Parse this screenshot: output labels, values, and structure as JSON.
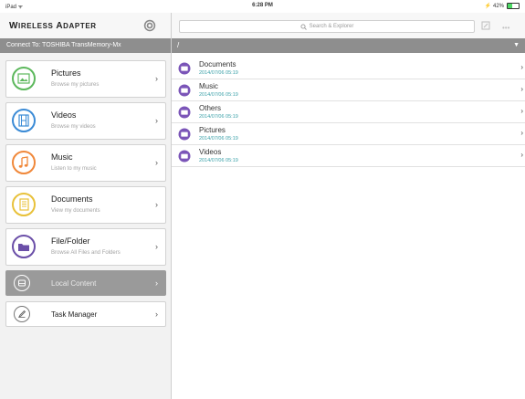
{
  "statusbar": {
    "carrier": "iPad ᯤ",
    "time": "6:28 PM",
    "battery": "⚡ 42%",
    "battery_level": 0.42
  },
  "sidebar": {
    "title_first": "W",
    "title_first_small": "IRELESS ",
    "title_second": "A",
    "title_second_small": "DAPTER",
    "connect": "Connect To: TOSHIBA  TransMemory-Mx",
    "items": [
      {
        "title": "Pictures",
        "subtitle": "Browse my pictures",
        "icon": "picture-icon",
        "color": "#5cb85c"
      },
      {
        "title": "Videos",
        "subtitle": "Browse my videos",
        "icon": "film-icon",
        "color": "#3b8bd6"
      },
      {
        "title": "Music",
        "subtitle": "Listen to my music",
        "icon": "music-note-icon",
        "color": "#f0883a"
      },
      {
        "title": "Documents",
        "subtitle": "View my documents",
        "icon": "document-icon",
        "color": "#e8c13a"
      },
      {
        "title": "File/Folder",
        "subtitle": "Browse All Files and Folders",
        "icon": "folder-icon",
        "color": "#6b4fa8"
      },
      {
        "title": "Local Content",
        "icon": "local-content-icon"
      },
      {
        "title": "Task Manager",
        "icon": "task-manager-icon"
      }
    ]
  },
  "main": {
    "search_placeholder": "Search & Explorer",
    "path": "/",
    "files": [
      {
        "name": "Documents",
        "date": "2014/07/06 05:19"
      },
      {
        "name": "Music",
        "date": "2014/07/06 05:19"
      },
      {
        "name": "Others",
        "date": "2014/07/06 05:19"
      },
      {
        "name": "Pictures",
        "date": "2014/07/06 05:19"
      },
      {
        "name": "Videos",
        "date": "2014/07/06 05:19"
      }
    ],
    "folder_color": "#7b55b8",
    "date_color": "#3aa0a8"
  }
}
